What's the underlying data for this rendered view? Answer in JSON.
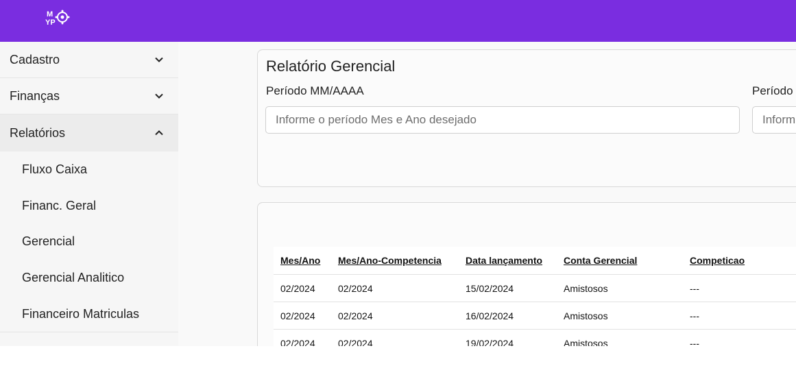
{
  "header": {
    "logo_text": [
      "M",
      "YP"
    ],
    "brand_color": "#7a2de0"
  },
  "sidebar": {
    "items": [
      {
        "label": "Cadastro",
        "icon": "chevron-down-icon"
      },
      {
        "label": "Finanças",
        "icon": "chevron-down-icon"
      },
      {
        "label": "Relatórios",
        "icon": "chevron-up-icon"
      }
    ],
    "subitems": [
      "Fluxo Caixa",
      "Financ. Geral",
      "Gerencial",
      "Gerencial Analitico",
      "Financeiro Matriculas"
    ]
  },
  "form": {
    "title": "Relatório Gerencial",
    "field1_label": "Período MM/AAAA",
    "field1_placeholder": "Informe o período Mes e Ano desejado",
    "field2_label": "Período",
    "field2_placeholder": "Inform"
  },
  "table": {
    "headers": [
      "Mes/Ano",
      "Mes/Ano-Competencia",
      "Data lançamento",
      "Conta Gerencial",
      "Competicao"
    ],
    "rows": [
      [
        "02/2024",
        "02/2024",
        "15/02/2024",
        "Amistosos",
        "---"
      ],
      [
        "02/2024",
        "02/2024",
        "16/02/2024",
        "Amistosos",
        "---"
      ],
      [
        "02/2024",
        "02/2024",
        "19/02/2024",
        "Amistosos",
        "---"
      ]
    ]
  }
}
